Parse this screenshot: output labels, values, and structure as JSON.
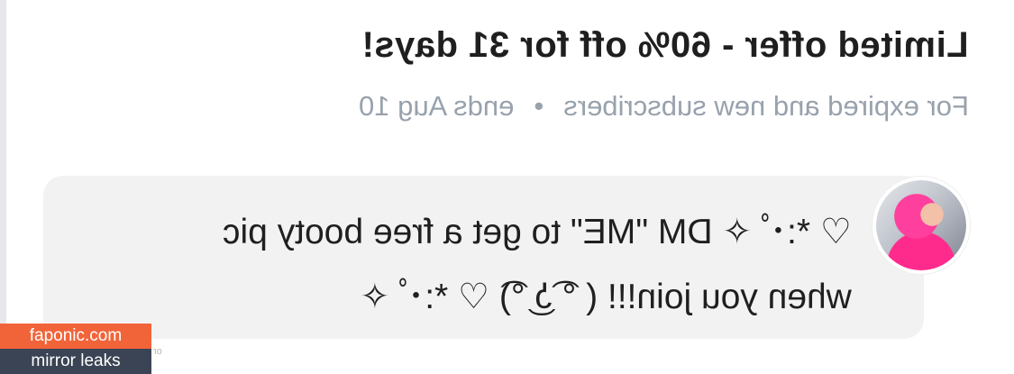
{
  "offer": {
    "title": "Limited offer - 60% off for 31 days!",
    "audience": "For expired and new subscribers",
    "separator": "•",
    "ends": "ends Aug 10"
  },
  "message": {
    "text": "♡ *:･ﾟ✧ DM \"ME\" to get a free booty pic\nwhen you join!!! ( ͡° ͜ʖ ͡°) ♡ *:･ﾟ✧"
  },
  "watermark": {
    "site": "faponic.com",
    "tagline": "mirror leaks"
  },
  "fragment": "or"
}
